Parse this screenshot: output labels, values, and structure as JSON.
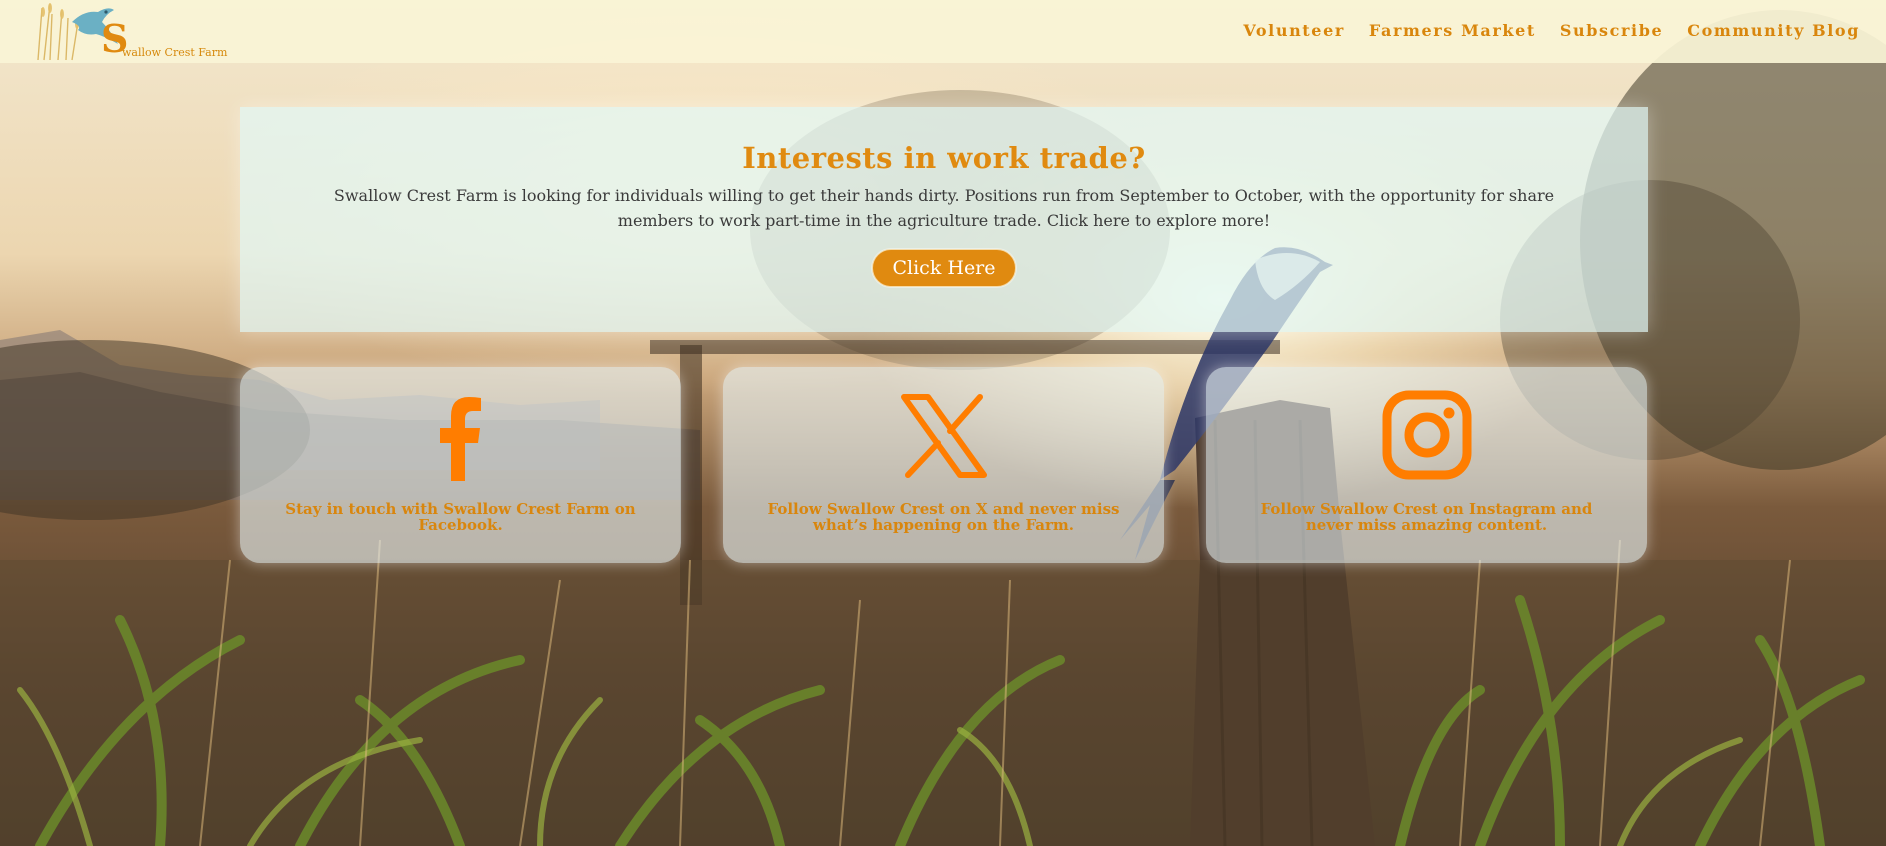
{
  "header": {
    "logo_text": "wallow Crest Farm",
    "logo_letter": "S",
    "nav": [
      "Volunteer",
      "Farmers Market",
      "Subscribe",
      "Community Blog"
    ]
  },
  "hero": {
    "title": "Interests in work trade?",
    "body": "Swallow Crest Farm is looking for individuals willing to get their hands dirty. Positions run from September to October, with the opportunity for share members to work part-time in the agriculture trade. Click here to explore more!",
    "button_label": "Click Here"
  },
  "social": [
    {
      "icon": "facebook-icon",
      "text": "Stay in touch with Swallow Crest Farm on Facebook."
    },
    {
      "icon": "x-icon",
      "text": "Follow Swallow Crest on X and never miss what’s happening on the Farm."
    },
    {
      "icon": "instagram-icon",
      "text": "Follow Swallow Crest on Instagram and never miss amazing content."
    }
  ],
  "colors": {
    "accent": "#e08a10",
    "header_bg": "#faf4d6",
    "panel_bg": "#e2f8f6",
    "body_text": "#3b3b3b"
  }
}
